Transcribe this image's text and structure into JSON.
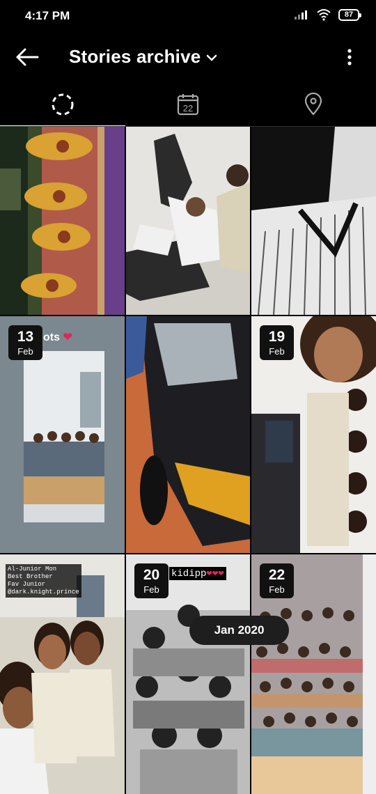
{
  "status": {
    "time": "4:17 PM",
    "battery": "87"
  },
  "header": {
    "title": "Stories archive"
  },
  "tabs": [
    {
      "name": "tab-grid",
      "active": true
    },
    {
      "name": "tab-calendar",
      "calendar_day": "22"
    },
    {
      "name": "tab-map"
    }
  ],
  "grid": {
    "items": [
      {
        "date": null
      },
      {
        "date": null
      },
      {
        "date": null
      },
      {
        "date": {
          "day": "13",
          "month": "Feb"
        },
        "caption": "ots"
      },
      {
        "date": null
      },
      {
        "date": {
          "day": "19",
          "month": "Feb"
        }
      },
      {
        "date": null,
        "caption": "Al-Junior Mon\nBest Brother\nFav Junior\n@dark.knight.prince"
      },
      {
        "date": {
          "day": "20",
          "month": "Feb"
        },
        "caption": "kidipp"
      },
      {
        "date": {
          "day": "22",
          "month": "Feb"
        }
      }
    ],
    "month_indicator": "Jan 2020"
  },
  "colors": {
    "accent": "#ffffff",
    "background": "#000000",
    "badge": "#111111",
    "heart": "#e0245e"
  }
}
